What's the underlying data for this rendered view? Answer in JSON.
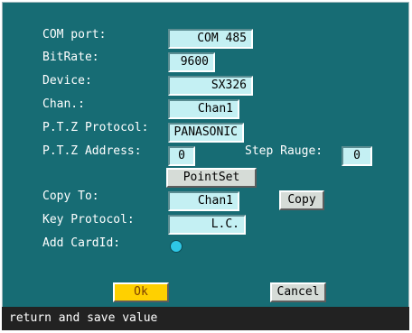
{
  "labels": {
    "com_port": "COM port:",
    "bitrate": "BitRate:",
    "device": "Device:",
    "chan": "Chan.:",
    "ptz_protocol": "P.T.Z Protocol:",
    "ptz_address": "P.T.Z Address:",
    "step_range": "Step Rauge:",
    "copy_to": "Copy To:",
    "key_protocol": "Key Protocol:",
    "add_cardid": "Add CardId:"
  },
  "values": {
    "com_port": "COM 485",
    "bitrate": "9600",
    "device": "SX326",
    "chan": "Chan1",
    "ptz_protocol": "PANASONIC",
    "ptz_address": "0",
    "step_range": "0",
    "copy_to": "Chan1",
    "key_protocol": "L.C."
  },
  "buttons": {
    "pointset": "PointSet",
    "copy": "Copy",
    "ok": "Ok",
    "cancel": "Cancel"
  },
  "status": "return and save value",
  "colors": {
    "background": "#176C74",
    "field": "#c4f0f3",
    "ok_button": "#ffd000",
    "radio": "#2ec7e6"
  }
}
